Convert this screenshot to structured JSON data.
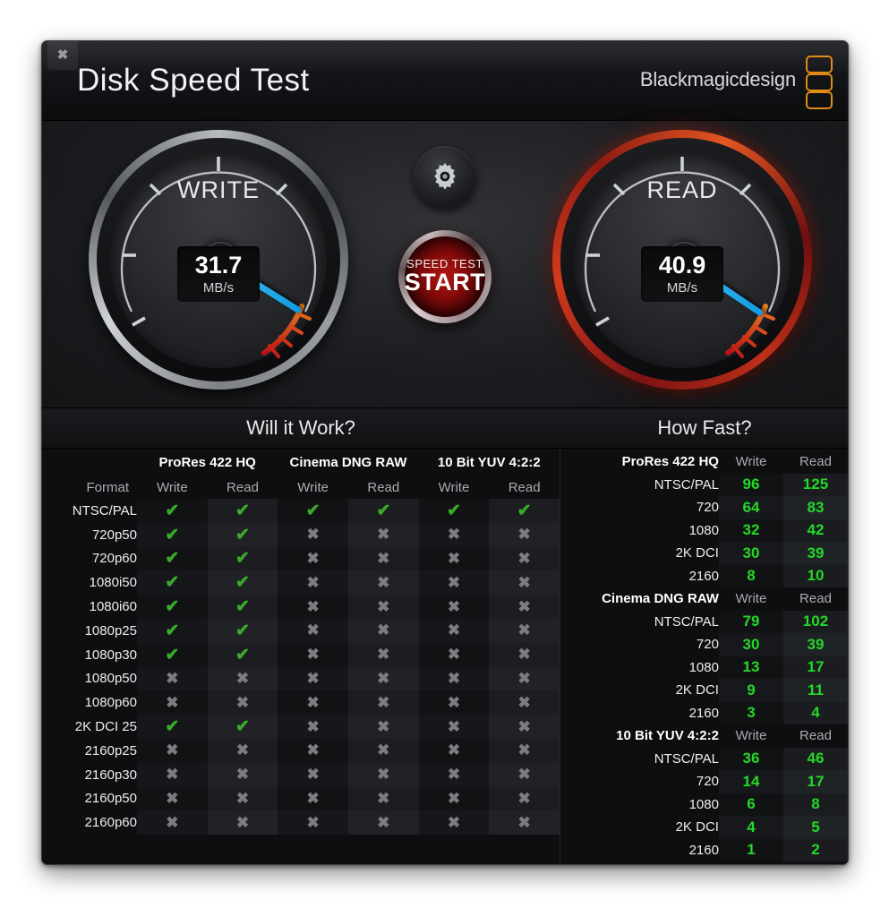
{
  "window": {
    "title": "Disk Speed Test",
    "close_label": "✖",
    "brand": "Blackmagicdesign"
  },
  "gauges": {
    "write": {
      "label": "WRITE",
      "value": "31.7",
      "unit": "MB/s",
      "needle_deg": 212
    },
    "read": {
      "label": "READ",
      "value": "40.9",
      "unit": "MB/s",
      "needle_deg": 214
    }
  },
  "controls": {
    "gear_icon": "gear-icon",
    "start_line1": "SPEED TEST",
    "start_line2": "START"
  },
  "panels": {
    "left_title": "Will it Work?",
    "right_title": "How Fast?"
  },
  "will_it_work": {
    "format_header": "Format",
    "groups": [
      "ProRes 422 HQ",
      "Cinema DNG RAW",
      "10 Bit YUV 4:2:2"
    ],
    "sub_headers": [
      "Write",
      "Read",
      "Write",
      "Read",
      "Write",
      "Read"
    ],
    "pass_mark": "✔",
    "fail_mark": "✖",
    "rows": [
      {
        "format": "NTSC/PAL",
        "cells": [
          true,
          true,
          true,
          true,
          true,
          true
        ]
      },
      {
        "format": "720p50",
        "cells": [
          true,
          true,
          false,
          false,
          false,
          false
        ]
      },
      {
        "format": "720p60",
        "cells": [
          true,
          true,
          false,
          false,
          false,
          false
        ]
      },
      {
        "format": "1080i50",
        "cells": [
          true,
          true,
          false,
          false,
          false,
          false
        ]
      },
      {
        "format": "1080i60",
        "cells": [
          true,
          true,
          false,
          false,
          false,
          false
        ]
      },
      {
        "format": "1080p25",
        "cells": [
          true,
          true,
          false,
          false,
          false,
          false
        ]
      },
      {
        "format": "1080p30",
        "cells": [
          true,
          true,
          false,
          false,
          false,
          false
        ]
      },
      {
        "format": "1080p50",
        "cells": [
          false,
          false,
          false,
          false,
          false,
          false
        ]
      },
      {
        "format": "1080p60",
        "cells": [
          false,
          false,
          false,
          false,
          false,
          false
        ]
      },
      {
        "format": "2K DCI 25",
        "cells": [
          true,
          true,
          false,
          false,
          false,
          false
        ]
      },
      {
        "format": "2160p25",
        "cells": [
          false,
          false,
          false,
          false,
          false,
          false
        ]
      },
      {
        "format": "2160p30",
        "cells": [
          false,
          false,
          false,
          false,
          false,
          false
        ]
      },
      {
        "format": "2160p50",
        "cells": [
          false,
          false,
          false,
          false,
          false,
          false
        ]
      },
      {
        "format": "2160p60",
        "cells": [
          false,
          false,
          false,
          false,
          false,
          false
        ]
      }
    ]
  },
  "how_fast": {
    "write_header": "Write",
    "read_header": "Read",
    "sections": [
      {
        "name": "ProRes 422 HQ",
        "rows": [
          {
            "label": "NTSC/PAL",
            "write": "96",
            "read": "125"
          },
          {
            "label": "720",
            "write": "64",
            "read": "83"
          },
          {
            "label": "1080",
            "write": "32",
            "read": "42"
          },
          {
            "label": "2K DCI",
            "write": "30",
            "read": "39"
          },
          {
            "label": "2160",
            "write": "8",
            "read": "10"
          }
        ]
      },
      {
        "name": "Cinema DNG RAW",
        "rows": [
          {
            "label": "NTSC/PAL",
            "write": "79",
            "read": "102"
          },
          {
            "label": "720",
            "write": "30",
            "read": "39"
          },
          {
            "label": "1080",
            "write": "13",
            "read": "17"
          },
          {
            "label": "2K DCI",
            "write": "9",
            "read": "11"
          },
          {
            "label": "2160",
            "write": "3",
            "read": "4"
          }
        ]
      },
      {
        "name": "10 Bit YUV 4:2:2",
        "rows": [
          {
            "label": "NTSC/PAL",
            "write": "36",
            "read": "46"
          },
          {
            "label": "720",
            "write": "14",
            "read": "17"
          },
          {
            "label": "1080",
            "write": "6",
            "read": "8"
          },
          {
            "label": "2K DCI",
            "write": "4",
            "read": "5"
          },
          {
            "label": "2160",
            "write": "1",
            "read": "2"
          }
        ]
      }
    ]
  },
  "colors": {
    "accent_orange": "#e08a18",
    "needle_blue": "#2bb3ef",
    "pass_green": "#3ba82d",
    "value_green": "#24d827",
    "danger_red": "#c8281a"
  }
}
